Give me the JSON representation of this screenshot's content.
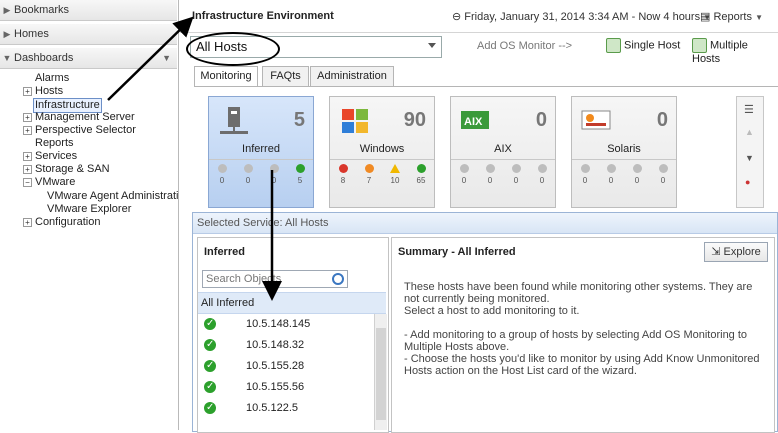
{
  "leftnav": {
    "bookmarks": "Bookmarks",
    "homes": "Homes",
    "dashboards": "Dashboards",
    "items": [
      {
        "label": "Alarms",
        "expand": false
      },
      {
        "label": "Hosts",
        "expand": true
      },
      {
        "label": "Infrastructure",
        "expand": false,
        "selected": true
      },
      {
        "label": "Management Server",
        "expand": true
      },
      {
        "label": "Perspective Selector",
        "expand": true
      },
      {
        "label": "Reports",
        "expand": false
      },
      {
        "label": "Services",
        "expand": true
      },
      {
        "label": "Storage & SAN",
        "expand": true
      },
      {
        "label": "VMware",
        "expand": false,
        "minus": true
      },
      {
        "label": "VMware Agent Administrati",
        "expand": false,
        "child": true
      },
      {
        "label": "VMware Explorer",
        "expand": false,
        "child": true
      },
      {
        "label": "Configuration",
        "expand": true
      }
    ]
  },
  "header": {
    "title": "Infrastructure Environment",
    "date": "Friday, January 31, 2014 3:34 AM - Now 4 hours",
    "reports": "Reports"
  },
  "filter": {
    "selected": "All Hosts",
    "add_os_monitor": "Add OS Monitor -->",
    "single_host": "Single Host",
    "multiple_hosts": "Multiple Hosts"
  },
  "tabs": [
    {
      "label": "Monitoring"
    },
    {
      "label": "FAQts"
    },
    {
      "label": "Administration"
    }
  ],
  "tiles": [
    {
      "name": "Inferred",
      "count": "5",
      "stats": [
        "0",
        "0",
        "0",
        "5"
      ]
    },
    {
      "name": "Windows",
      "count": "90",
      "stats": [
        "8",
        "7",
        "10",
        "65"
      ]
    },
    {
      "name": "AIX",
      "count": "0",
      "stats": [
        "0",
        "0",
        "0",
        "0"
      ]
    },
    {
      "name": "Solaris",
      "count": "0",
      "stats": [
        "0",
        "0",
        "0",
        "0"
      ]
    }
  ],
  "service": {
    "header": "Selected Service: All Hosts",
    "left_title": "Inferred",
    "search_placeholder": "Search Objects",
    "all_inferred": "All Inferred",
    "hosts": [
      "10.5.148.145",
      "10.5.148.32",
      "10.5.155.28",
      "10.5.155.56",
      "10.5.122.5"
    ],
    "summary_title": "Summary - All Inferred",
    "explore": "Explore",
    "para1": "These hosts have been found while monitoring other systems. They are not currently being monitored.",
    "para1b": "Select a host to add monitoring to it.",
    "para2": "- Add monitoring to a group of hosts by selecting Add OS Monitoring to Multiple Hosts above.",
    "para3": "- Choose the hosts you'd like to monitor by using Add Know Unmonitored Hosts action on the Host List card of the wizard."
  },
  "colors": {
    "accent": "#3b77c1",
    "ok": "#2ca02c",
    "critical": "#d9362b",
    "warning": "#f0b800"
  }
}
